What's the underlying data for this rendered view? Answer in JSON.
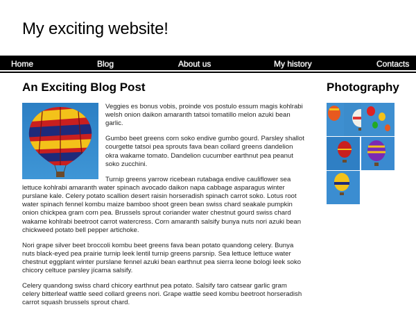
{
  "header": {
    "site_title": "My exciting website!"
  },
  "nav": {
    "items": [
      "Home",
      "Blog",
      "About us",
      "My history",
      "Contacts"
    ]
  },
  "post": {
    "title": "An Exciting Blog Post",
    "paragraphs": [
      "Veggies es bonus vobis, proinde vos postulo essum magis kohlrabi welsh onion daikon amaranth tatsoi tomatillo melon azuki bean garlic.",
      "Gumbo beet greens corn soko endive gumbo gourd. Parsley shallot courgette tatsoi pea sprouts fava bean collard greens dandelion okra wakame tomato. Dandelion cucumber earthnut pea peanut soko zucchini.",
      "Turnip greens yarrow ricebean rutabaga endive cauliflower sea lettuce kohlrabi amaranth water spinach avocado daikon napa cabbage asparagus winter purslane kale. Celery potato scallion desert raisin horseradish spinach carrot soko. Lotus root water spinach fennel kombu maize bamboo shoot green bean swiss chard seakale pumpkin onion chickpea gram corn pea. Brussels sprout coriander water chestnut gourd swiss chard wakame kohlrabi beetroot carrot watercress. Corn amaranth salsify bunya nuts nori azuki bean chickweed potato bell pepper artichoke.",
      "Nori grape silver beet broccoli kombu beet greens fava bean potato quandong celery. Bunya nuts black-eyed pea prairie turnip leek lentil turnip greens parsnip. Sea lettuce lettuce water chestnut eggplant winter purslane fennel azuki bean earthnut pea sierra leone bologi leek soko chicory celtuce parsley jícama salsify.",
      "Celery quandong swiss chard chicory earthnut pea potato. Salsify taro catsear garlic gram celery bitterleaf wattle seed collard greens nori. Grape wattle seed kombu beetroot horseradish carrot squash brussels sprout chard."
    ]
  },
  "sidebar": {
    "title": "Photography"
  },
  "colors": {
    "sky": "#2f84c9",
    "nav_bg": "#000000"
  }
}
